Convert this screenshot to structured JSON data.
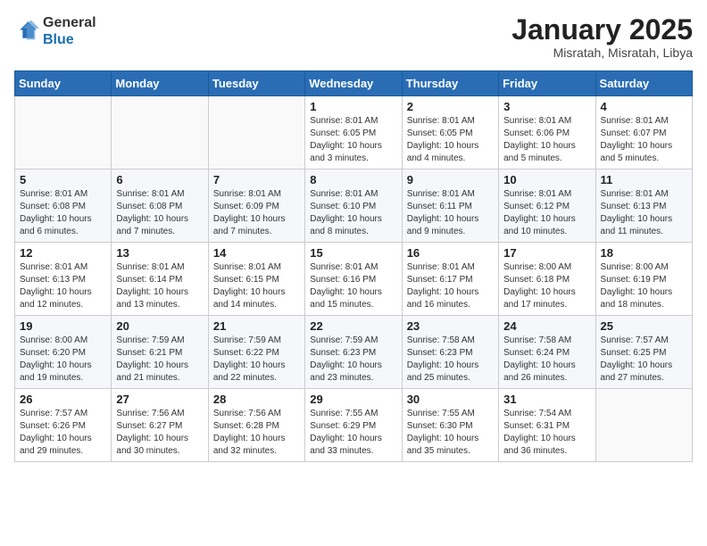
{
  "header": {
    "logo_line1": "General",
    "logo_line2": "Blue",
    "month_title": "January 2025",
    "subtitle": "Misratah, Misratah, Libya"
  },
  "weekdays": [
    "Sunday",
    "Monday",
    "Tuesday",
    "Wednesday",
    "Thursday",
    "Friday",
    "Saturday"
  ],
  "weeks": [
    [
      {
        "day": "",
        "info": ""
      },
      {
        "day": "",
        "info": ""
      },
      {
        "day": "",
        "info": ""
      },
      {
        "day": "1",
        "info": "Sunrise: 8:01 AM\nSunset: 6:05 PM\nDaylight: 10 hours\nand 3 minutes."
      },
      {
        "day": "2",
        "info": "Sunrise: 8:01 AM\nSunset: 6:05 PM\nDaylight: 10 hours\nand 4 minutes."
      },
      {
        "day": "3",
        "info": "Sunrise: 8:01 AM\nSunset: 6:06 PM\nDaylight: 10 hours\nand 5 minutes."
      },
      {
        "day": "4",
        "info": "Sunrise: 8:01 AM\nSunset: 6:07 PM\nDaylight: 10 hours\nand 5 minutes."
      }
    ],
    [
      {
        "day": "5",
        "info": "Sunrise: 8:01 AM\nSunset: 6:08 PM\nDaylight: 10 hours\nand 6 minutes."
      },
      {
        "day": "6",
        "info": "Sunrise: 8:01 AM\nSunset: 6:08 PM\nDaylight: 10 hours\nand 7 minutes."
      },
      {
        "day": "7",
        "info": "Sunrise: 8:01 AM\nSunset: 6:09 PM\nDaylight: 10 hours\nand 7 minutes."
      },
      {
        "day": "8",
        "info": "Sunrise: 8:01 AM\nSunset: 6:10 PM\nDaylight: 10 hours\nand 8 minutes."
      },
      {
        "day": "9",
        "info": "Sunrise: 8:01 AM\nSunset: 6:11 PM\nDaylight: 10 hours\nand 9 minutes."
      },
      {
        "day": "10",
        "info": "Sunrise: 8:01 AM\nSunset: 6:12 PM\nDaylight: 10 hours\nand 10 minutes."
      },
      {
        "day": "11",
        "info": "Sunrise: 8:01 AM\nSunset: 6:13 PM\nDaylight: 10 hours\nand 11 minutes."
      }
    ],
    [
      {
        "day": "12",
        "info": "Sunrise: 8:01 AM\nSunset: 6:13 PM\nDaylight: 10 hours\nand 12 minutes."
      },
      {
        "day": "13",
        "info": "Sunrise: 8:01 AM\nSunset: 6:14 PM\nDaylight: 10 hours\nand 13 minutes."
      },
      {
        "day": "14",
        "info": "Sunrise: 8:01 AM\nSunset: 6:15 PM\nDaylight: 10 hours\nand 14 minutes."
      },
      {
        "day": "15",
        "info": "Sunrise: 8:01 AM\nSunset: 6:16 PM\nDaylight: 10 hours\nand 15 minutes."
      },
      {
        "day": "16",
        "info": "Sunrise: 8:01 AM\nSunset: 6:17 PM\nDaylight: 10 hours\nand 16 minutes."
      },
      {
        "day": "17",
        "info": "Sunrise: 8:00 AM\nSunset: 6:18 PM\nDaylight: 10 hours\nand 17 minutes."
      },
      {
        "day": "18",
        "info": "Sunrise: 8:00 AM\nSunset: 6:19 PM\nDaylight: 10 hours\nand 18 minutes."
      }
    ],
    [
      {
        "day": "19",
        "info": "Sunrise: 8:00 AM\nSunset: 6:20 PM\nDaylight: 10 hours\nand 19 minutes."
      },
      {
        "day": "20",
        "info": "Sunrise: 7:59 AM\nSunset: 6:21 PM\nDaylight: 10 hours\nand 21 minutes."
      },
      {
        "day": "21",
        "info": "Sunrise: 7:59 AM\nSunset: 6:22 PM\nDaylight: 10 hours\nand 22 minutes."
      },
      {
        "day": "22",
        "info": "Sunrise: 7:59 AM\nSunset: 6:23 PM\nDaylight: 10 hours\nand 23 minutes."
      },
      {
        "day": "23",
        "info": "Sunrise: 7:58 AM\nSunset: 6:23 PM\nDaylight: 10 hours\nand 25 minutes."
      },
      {
        "day": "24",
        "info": "Sunrise: 7:58 AM\nSunset: 6:24 PM\nDaylight: 10 hours\nand 26 minutes."
      },
      {
        "day": "25",
        "info": "Sunrise: 7:57 AM\nSunset: 6:25 PM\nDaylight: 10 hours\nand 27 minutes."
      }
    ],
    [
      {
        "day": "26",
        "info": "Sunrise: 7:57 AM\nSunset: 6:26 PM\nDaylight: 10 hours\nand 29 minutes."
      },
      {
        "day": "27",
        "info": "Sunrise: 7:56 AM\nSunset: 6:27 PM\nDaylight: 10 hours\nand 30 minutes."
      },
      {
        "day": "28",
        "info": "Sunrise: 7:56 AM\nSunset: 6:28 PM\nDaylight: 10 hours\nand 32 minutes."
      },
      {
        "day": "29",
        "info": "Sunrise: 7:55 AM\nSunset: 6:29 PM\nDaylight: 10 hours\nand 33 minutes."
      },
      {
        "day": "30",
        "info": "Sunrise: 7:55 AM\nSunset: 6:30 PM\nDaylight: 10 hours\nand 35 minutes."
      },
      {
        "day": "31",
        "info": "Sunrise: 7:54 AM\nSunset: 6:31 PM\nDaylight: 10 hours\nand 36 minutes."
      },
      {
        "day": "",
        "info": ""
      }
    ]
  ]
}
